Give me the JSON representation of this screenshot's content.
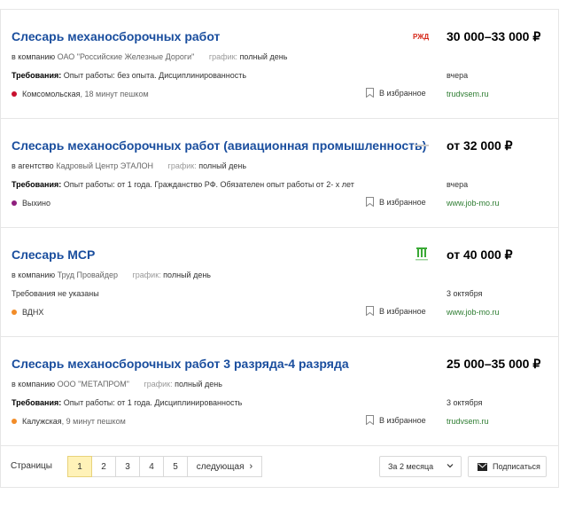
{
  "colors": {
    "title_link": "#1a4e9e",
    "source_link": "#2e7d32",
    "active_page": "#fff2b8"
  },
  "vacancies": [
    {
      "title": "Слесарь механосборочных работ",
      "salary": "30 000–33 000 ₽",
      "logo": "rzd-logo",
      "company_prefix": "в компанию",
      "company": "ОАО \"Российские Железные Дороги\"",
      "schedule_label": "график:",
      "schedule": "полный день",
      "requirements_label": "Требования:",
      "requirements": "Опыт работы: без опыта. Дисциплинированность",
      "date": "вчера",
      "metro": "Комсомольская",
      "metro_walk": ", 18 минут пешком",
      "metro_color": "#c8102e",
      "favorite": "В избранное",
      "source": "trudvsem.ru"
    },
    {
      "title": "Слесарь механосборочных работ (авиационная промышленность)",
      "salary": "от 32 000 ₽",
      "logo": "etalon-logo",
      "company_prefix": "в агентство",
      "company": "Кадровый Центр ЭТАЛОН",
      "schedule_label": "график:",
      "schedule": "полный день",
      "requirements_label": "Требования:",
      "requirements": "Опыт работы: от 1 года. Гражданство РФ. Обязателен опыт работы от 2- х лет",
      "date": "вчера",
      "metro": "Выхино",
      "metro_walk": "",
      "metro_color": "#8e1e7d",
      "favorite": "В избранное",
      "source": "www.job-mo.ru"
    },
    {
      "title": "Слесарь МСР",
      "salary": "от 40 000 ₽",
      "logo": "trud-provider-logo",
      "company_prefix": "в компанию",
      "company": "Труд Провайдер",
      "schedule_label": "график:",
      "schedule": "полный день",
      "requirements_label": "",
      "requirements": "Требования не указаны",
      "date": "3 октября",
      "metro": "ВДНХ",
      "metro_walk": "",
      "metro_color": "#f28c28",
      "favorite": "В избранное",
      "source": "www.job-mo.ru"
    },
    {
      "title": "Слесарь механосборочных работ 3 разряда-4 разряда",
      "salary": "25 000–35 000 ₽",
      "logo": "",
      "company_prefix": "в компанию",
      "company": "ООО \"МЕТАПРОМ\"",
      "schedule_label": "график:",
      "schedule": "полный день",
      "requirements_label": "Требования:",
      "requirements": "Опыт работы: от 1 года. Дисциплинированность",
      "date": "3 октября",
      "metro": "Калужская",
      "metro_walk": ", 9 минут пешком",
      "metro_color": "#f28c28",
      "favorite": "В избранное",
      "source": "trudvsem.ru"
    }
  ],
  "pagination": {
    "label": "Страницы",
    "pages": [
      "1",
      "2",
      "3",
      "4",
      "5"
    ],
    "active_page": "1",
    "next": "следующая",
    "period": "За 2 месяца",
    "subscribe": "Подписаться"
  }
}
